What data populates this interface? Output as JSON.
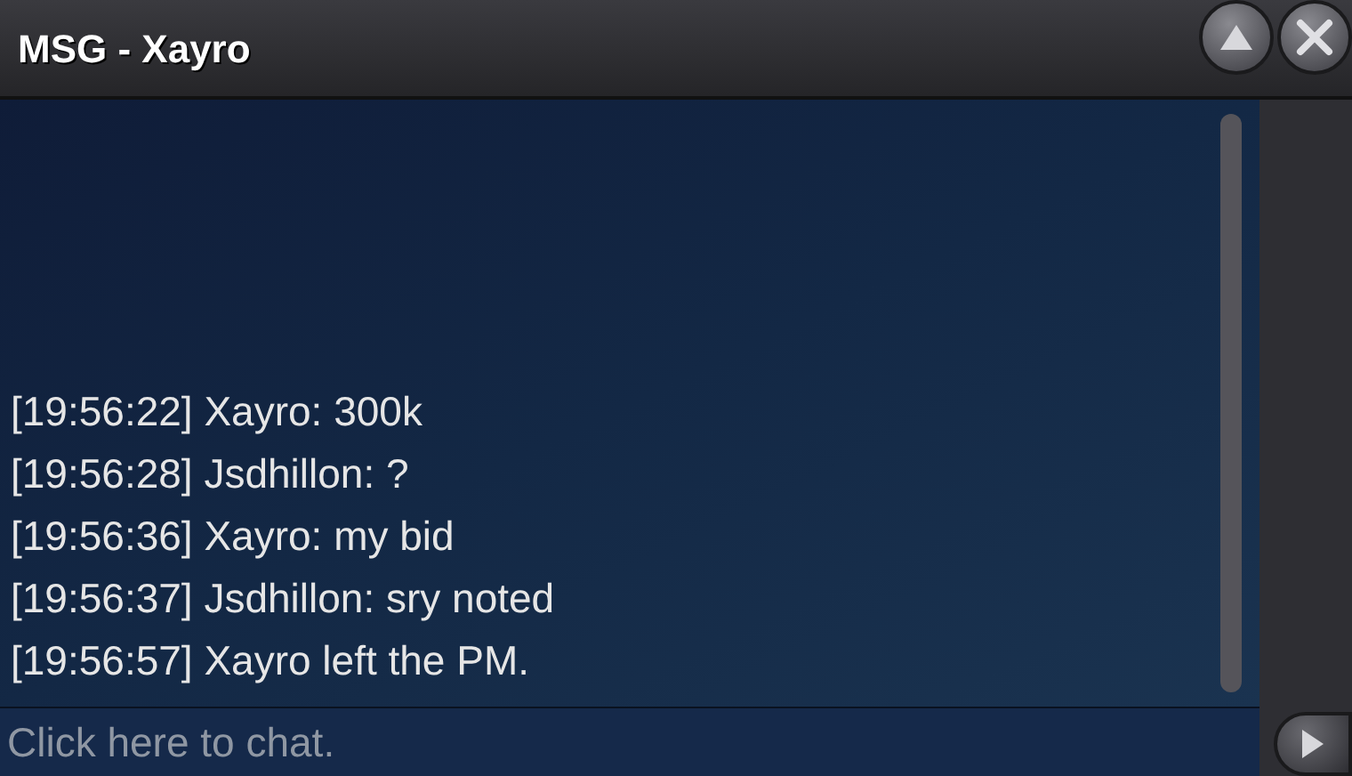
{
  "window": {
    "title": "MSG - Xayro"
  },
  "messages": [
    "[19:56:22] Xayro: 300k",
    "[19:56:28] Jsdhillon: ?",
    "[19:56:36] Xayro: my bid",
    "[19:56:37] Jsdhillon: sry noted",
    "[19:56:57] Xayro left the PM."
  ],
  "chat_input": {
    "placeholder": "Click here to chat."
  }
}
